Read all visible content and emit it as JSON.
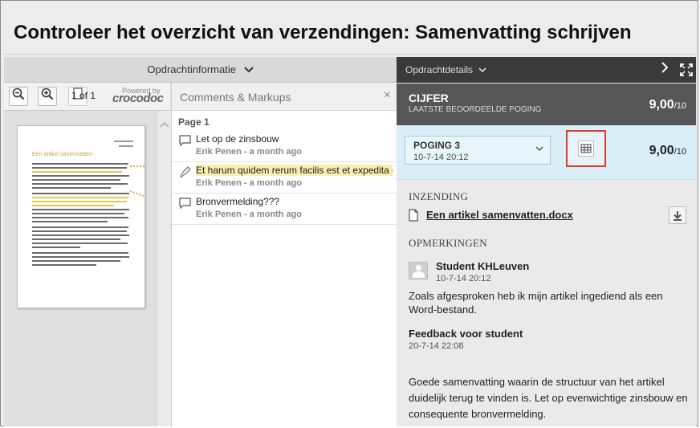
{
  "title": "Controleer het overzicht van verzendingen: Samenvatting schrijven",
  "left_panel": {
    "header_label": "Opdrachtinformatie",
    "page_indicator": "1 of 1",
    "powered_by": "Powered by",
    "brand": "crocodoc",
    "thumbnail_heading": "Een artikel samenvatten"
  },
  "comments": {
    "header": "Comments & Markups",
    "close": "×",
    "page_label": "Page 1",
    "items": [
      {
        "text": "Let op de zinsbouw",
        "author": "Erik Penen",
        "time": "a month ago",
        "type": "comment"
      },
      {
        "text": "Et harum quidem rerum facilis est et expedita distinctio",
        "author": "Erik Penen",
        "time": "a month ago",
        "type": "highlight"
      },
      {
        "text": "Bronvermelding???",
        "author": "Erik Penen",
        "time": "a month ago",
        "type": "comment"
      }
    ]
  },
  "right_panel": {
    "header_label": "Opdrachtdetails",
    "cijfer": {
      "heading": "CIJFER",
      "subheading": "LAATSTE BEOORDEELDE POGING",
      "score": "9,00",
      "max": "/10"
    },
    "poging": {
      "label": "POGING 3",
      "date": "10-7-14 20:12",
      "score": "9,00",
      "max": "/10"
    },
    "inzending_label": "INZENDING",
    "file_name": "Een artikel samenvatten.docx",
    "opmerkingen_label": "OPMERKINGEN",
    "student_name": "Student KHLeuven",
    "student_date": "10-7-14 20:12",
    "student_message": "Zoals afgesproken heb ik mijn artikel ingediend als een Word-bestand.",
    "feedback_title": "Feedback voor student",
    "feedback_date": "20-7-14 22:08",
    "feedback_text": "Goede samenvatting waarin de structuur van het artikel duidelijk terug te vinden is. Let op evenwichtige zinsbouw en consequente bronvermelding."
  },
  "colors": {
    "dark_header": "#3a3a3a",
    "grade_bar": "#565656",
    "attempt_bg": "#d9eef7",
    "highlight": "#f7eeb0",
    "focus_outline": "#e0392f"
  }
}
